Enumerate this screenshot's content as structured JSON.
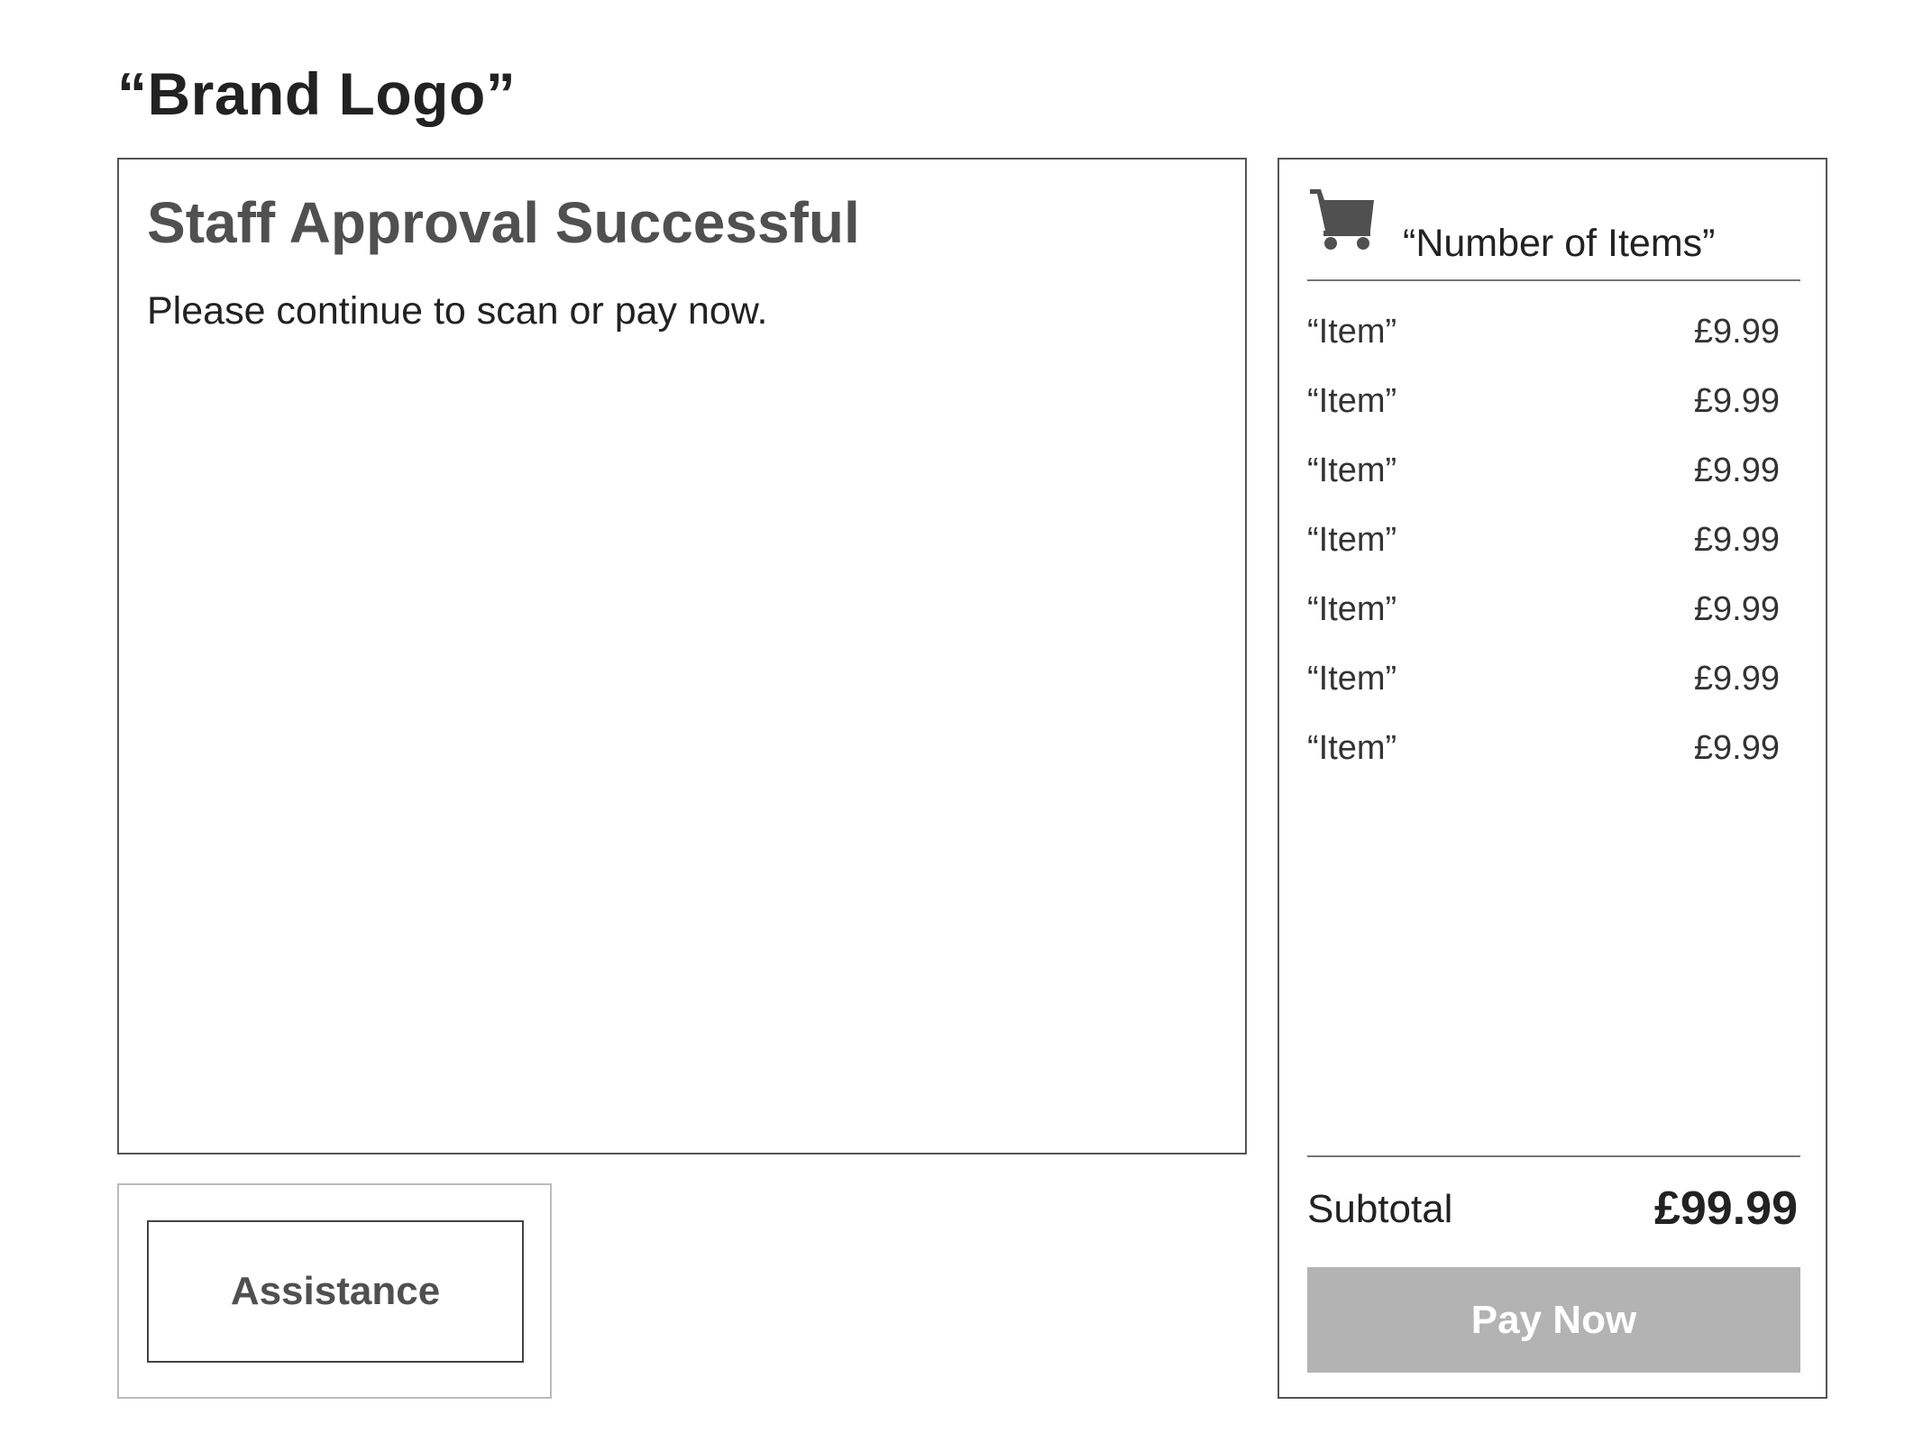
{
  "header": {
    "brand_logo": "“Brand Logo”"
  },
  "main": {
    "title": "Staff Approval Successful",
    "message": "Please continue to scan or pay now."
  },
  "assistance": {
    "button_label": "Assistance"
  },
  "cart": {
    "icon": "shopping-cart-icon",
    "count_label": "“Number of Items”",
    "items": [
      {
        "name": "“Item”",
        "price": "£9.99"
      },
      {
        "name": "“Item”",
        "price": "£9.99"
      },
      {
        "name": "“Item”",
        "price": "£9.99"
      },
      {
        "name": "“Item”",
        "price": "£9.99"
      },
      {
        "name": "“Item”",
        "price": "£9.99"
      },
      {
        "name": "“Item”",
        "price": "£9.99"
      },
      {
        "name": "“Item”",
        "price": "£9.99"
      }
    ],
    "subtotal_label": "Subtotal",
    "subtotal_value": "£99.99",
    "pay_button_label": "Pay Now"
  },
  "colors": {
    "title_gray": "#505050",
    "pay_button_bg": "#b3b3b3",
    "text_dark": "#222222"
  }
}
